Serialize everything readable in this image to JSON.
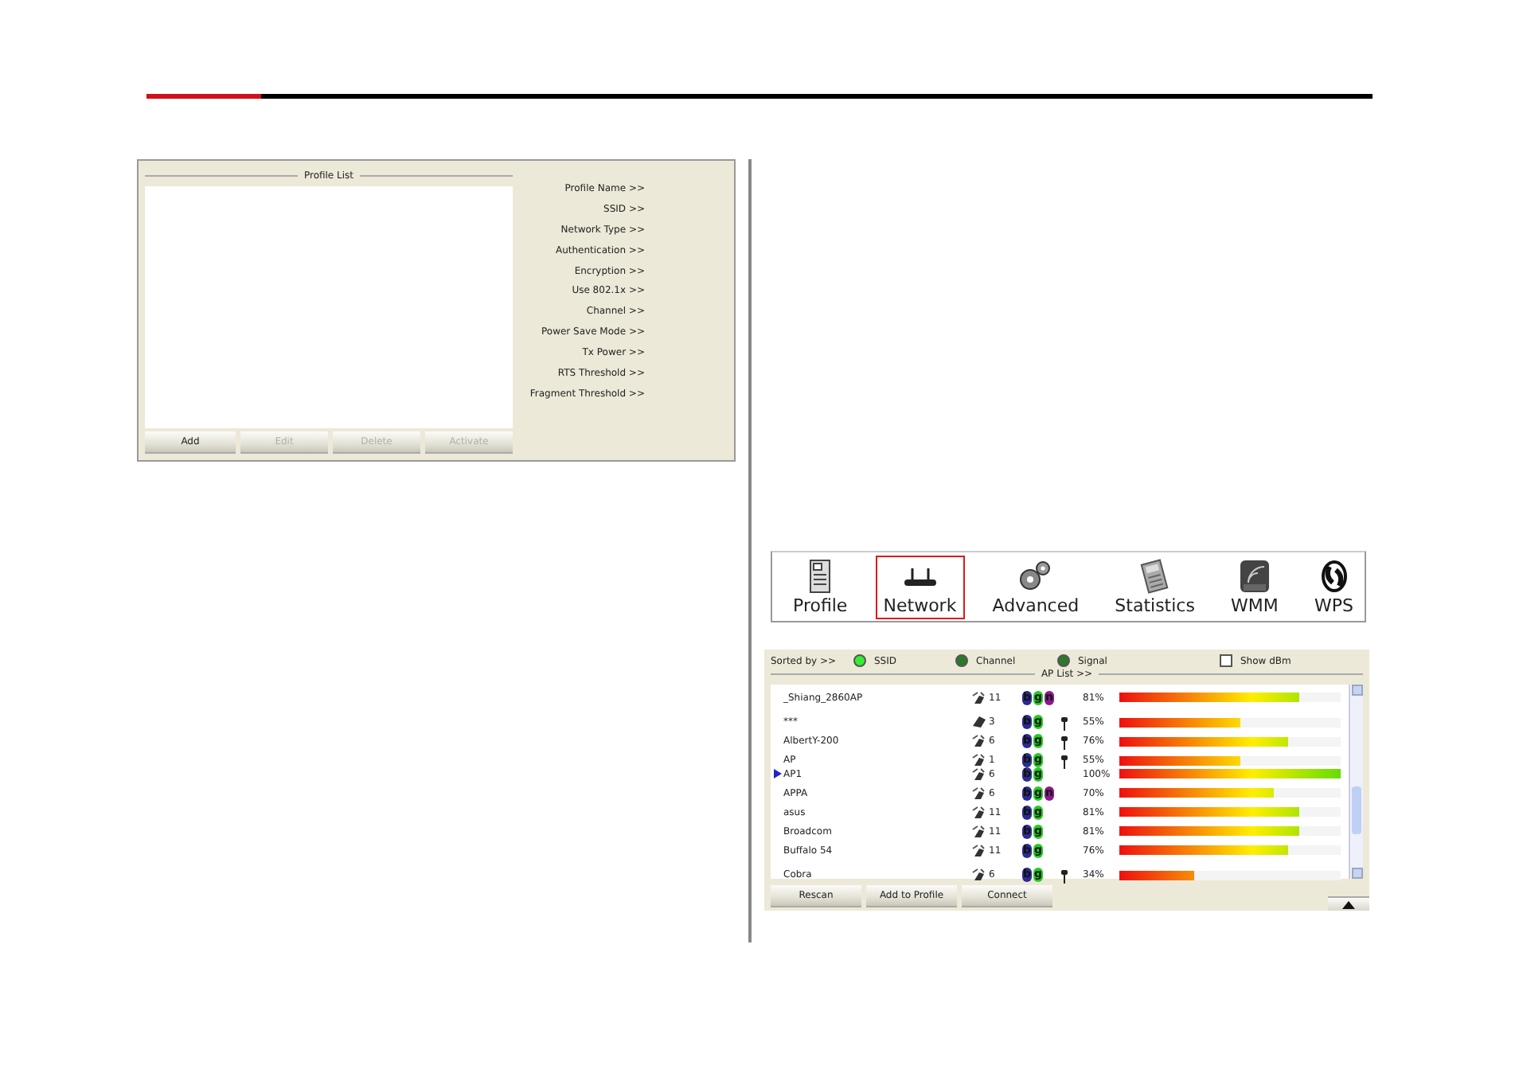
{
  "profile_panel": {
    "list_title": "Profile List",
    "buttons": [
      {
        "label": "Add",
        "disabled": false
      },
      {
        "label": "Edit",
        "disabled": true
      },
      {
        "label": "Delete",
        "disabled": true
      },
      {
        "label": "Activate",
        "disabled": true
      }
    ],
    "fields": [
      "Profile Name >>",
      "SSID >>",
      "Network Type >>",
      "Authentication >>",
      "Encryption >>",
      "Use 802.1x >>",
      "Channel >>",
      "Power Save Mode >>",
      "Tx Power >>",
      "RTS Threshold >>",
      "Fragment Threshold >>"
    ]
  },
  "toolbar": [
    {
      "label": "Profile",
      "kind": "profile",
      "selected": false
    },
    {
      "label": "Network",
      "kind": "network",
      "selected": true
    },
    {
      "label": "Advanced",
      "kind": "advanced",
      "selected": false
    },
    {
      "label": "Statistics",
      "kind": "statistics",
      "selected": false
    },
    {
      "label": "WMM",
      "kind": "wmm",
      "selected": false
    },
    {
      "label": "WPS",
      "kind": "wps",
      "selected": false
    }
  ],
  "ap_panel": {
    "sorted_by": "Sorted by >>",
    "sort_options": [
      {
        "label": "SSID",
        "selected": true
      },
      {
        "label": "Channel",
        "selected": false
      },
      {
        "label": "Signal",
        "selected": false
      }
    ],
    "show_dbm": {
      "label": "Show dBm",
      "checked": false
    },
    "list_title": "AP List >>",
    "rows": [
      {
        "ssid": "_Shiang_2860AP",
        "channel": "11",
        "kind": "infrastructure",
        "modes": [
          {
            "label": "b",
            "color": "#2b2b8f"
          },
          {
            "label": "g",
            "color": "#22cc22"
          },
          {
            "label": "n",
            "color": "#8a1a8a"
          }
        ],
        "encrypted": false,
        "signal": "81%",
        "level": 0.81,
        "selected": false
      },
      {
        "ssid": "***",
        "channel": "3",
        "kind": "adhoc",
        "modes": [
          {
            "label": "b",
            "color": "#2b2b8f"
          },
          {
            "label": "g",
            "color": "#22cc22"
          }
        ],
        "encrypted": true,
        "signal": "55%",
        "level": 0.55,
        "selected": false
      },
      {
        "ssid": "AlbertY-200",
        "channel": "6",
        "kind": "infrastructure",
        "modes": [
          {
            "label": "b",
            "color": "#2b2b8f"
          },
          {
            "label": "g",
            "color": "#22cc22"
          }
        ],
        "encrypted": true,
        "signal": "76%",
        "level": 0.76,
        "selected": false
      },
      {
        "ssid": "AP",
        "channel": "1",
        "kind": "infrastructure",
        "modes": [
          {
            "label": "b",
            "color": "#2b2b8f"
          },
          {
            "label": "g",
            "color": "#22cc22"
          }
        ],
        "encrypted": true,
        "signal": "55%",
        "level": 0.55,
        "selected": false
      },
      {
        "ssid": "AP1",
        "channel": "6",
        "kind": "infrastructure",
        "modes": [
          {
            "label": "b",
            "color": "#2b2b8f"
          },
          {
            "label": "g",
            "color": "#22cc22"
          }
        ],
        "encrypted": false,
        "signal": "100%",
        "level": 1.0,
        "selected": true
      },
      {
        "ssid": "APPA",
        "channel": "6",
        "kind": "infrastructure",
        "modes": [
          {
            "label": "b",
            "color": "#2b2b8f"
          },
          {
            "label": "g",
            "color": "#22cc22"
          },
          {
            "label": "n",
            "color": "#8a1a8a"
          }
        ],
        "encrypted": false,
        "signal": "70%",
        "level": 0.7,
        "selected": false
      },
      {
        "ssid": "asus",
        "channel": "11",
        "kind": "infrastructure",
        "modes": [
          {
            "label": "b",
            "color": "#2b2b8f"
          },
          {
            "label": "g",
            "color": "#22cc22"
          }
        ],
        "encrypted": false,
        "signal": "81%",
        "level": 0.81,
        "selected": false
      },
      {
        "ssid": "Broadcom",
        "channel": "11",
        "kind": "infrastructure",
        "modes": [
          {
            "label": "b",
            "color": "#2b2b8f"
          },
          {
            "label": "g",
            "color": "#22cc22"
          }
        ],
        "encrypted": false,
        "signal": "81%",
        "level": 0.81,
        "selected": false
      },
      {
        "ssid": "Buffalo 54",
        "channel": "11",
        "kind": "infrastructure",
        "modes": [
          {
            "label": "b",
            "color": "#2b2b8f"
          },
          {
            "label": "g",
            "color": "#22cc22"
          }
        ],
        "encrypted": false,
        "signal": "76%",
        "level": 0.76,
        "selected": false
      },
      {
        "ssid": "Cobra",
        "channel": "6",
        "kind": "infrastructure",
        "modes": [
          {
            "label": "b",
            "color": "#2b2b8f"
          },
          {
            "label": "g",
            "color": "#22cc22"
          }
        ],
        "encrypted": true,
        "signal": "34%",
        "level": 0.34,
        "selected": false
      }
    ],
    "buttons": [
      "Rescan",
      "Add to Profile",
      "Connect"
    ]
  }
}
